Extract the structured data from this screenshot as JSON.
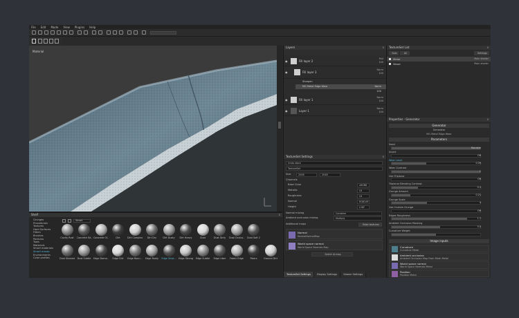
{
  "menu": [
    "File",
    "Edit",
    "Mode",
    "View",
    "Plugins",
    "Help"
  ],
  "viewport": {
    "label": "Material"
  },
  "shelf": {
    "title": "Shelf",
    "search": "Smart",
    "categories": [
      "Grunges",
      "Procedurals",
      "Textures",
      "Hard Surfaces",
      "Filters",
      "Brushes",
      "Particles",
      "Tools",
      "Materials",
      "Smart materials",
      "Smart masks",
      "Environments",
      "Color profiles"
    ],
    "selected_category": "Smart masks",
    "row1": [
      "Cavity Rust",
      "Concrete Ed...",
      "Concrete Ol...",
      "Dirt",
      "Dirt Complex",
      "Dirt Dry",
      "Dirt Dusty",
      "Dirt Heavy",
      "Dust",
      "Dust Dirty",
      "Dust Occlus...",
      "Dust Soft 2"
    ],
    "row2": [
      "Dust Stained",
      "Dust Subtle",
      "Edge Dama...",
      "Edge Dirt",
      "Edge Roun...",
      "Edge Rusty",
      "Edge Smal...",
      "Edge Strong",
      "Edge Subtle",
      "Edge Uber",
      "Fabric Edge",
      "Fibers",
      "Ground Dirt"
    ],
    "selected_material": "Edge Smal..."
  },
  "layers": {
    "title": "Layers",
    "items": [
      {
        "name": "Fill layer 2",
        "blend": "Mul",
        "opacity": "100"
      },
      {
        "name": "Fill layer 3",
        "blend": "Norm",
        "opacity": "100"
      },
      {
        "name": "Fill layer 1",
        "blend": "Norm",
        "opacity": "100"
      },
      {
        "name": "Layer 1",
        "blend": "Norm",
        "opacity": "100"
      }
    ],
    "effects": [
      {
        "name": "Sharpen",
        "blend": "",
        "opacity": ""
      },
      {
        "name": "MG Metal Edge Wear",
        "blend": "Norm",
        "opacity": "100"
      }
    ]
  },
  "textureset_settings": {
    "title": "TextureSet Settings",
    "undo": "Undo stack",
    "textureset": "TextureSet",
    "size_label": "Size",
    "size_value": "2048",
    "channels_label": "Channels",
    "channels": [
      {
        "name": "Base Color",
        "format": "sRGB8"
      },
      {
        "name": "Metallic",
        "format": "L8"
      },
      {
        "name": "Roughness",
        "format": "L8"
      },
      {
        "name": "Normal",
        "format": "RGB16F"
      },
      {
        "name": "Height",
        "format": "L16F"
      }
    ],
    "normal_mixing_label": "Normal mixing",
    "normal_mixing_value": "Combine",
    "ao_label": "Ambient occlusion mixing",
    "ao_value": "Multiply",
    "additional_maps": "Additional maps",
    "bake_button": "Bake textures",
    "maps": [
      {
        "title": "Normal",
        "sub": "NormalNormalMap"
      },
      {
        "title": "World space normal",
        "sub": "World Space Normals Map"
      }
    ],
    "select_button": "Select id map",
    "tabs": [
      "TextureSet Settings",
      "Display Settings",
      "Viewer Settings"
    ]
  },
  "textureset_list": {
    "title": "TextureSet List",
    "solo_label": "Solo",
    "all_label": "All",
    "settings_label": "Settings",
    "items": [
      {
        "name": "Metal",
        "shader": "Main shader"
      },
      {
        "name": "Wood",
        "shader": "Main shader"
      }
    ]
  },
  "properties": {
    "title": "Properties - Generator",
    "generator_header": "Generator",
    "generator_label": "Generator",
    "generator_value": "MG Metal Edge Wear",
    "parameters_header": "Parameters",
    "params": [
      {
        "label": "Seed",
        "value": "Random",
        "fill": 1.0
      },
      {
        "label": "Invert",
        "value": "Off",
        "fill": 0
      },
      {
        "label": "Wear Level",
        "value": "0.39",
        "fill": 0.39
      },
      {
        "label": "Wear Contrast",
        "value": "1",
        "fill": 1.0
      },
      {
        "label": "Use Triplanar",
        "value": "Off",
        "fill": 0
      },
      {
        "label": "Triplanar Blending Contrast",
        "value": "0.3",
        "fill": 0.3
      },
      {
        "label": "Grunge Amount",
        "value": "0.21",
        "fill": 0.21
      },
      {
        "label": "Grunge Scale",
        "value": "4",
        "fill": 0.4
      },
      {
        "label": "Use Custom Grunge",
        "value": "Off",
        "fill": 0
      },
      {
        "label": "Edges Roughness",
        "value": "1.7",
        "fill": 0.85
      },
      {
        "label": "Ambient Occlusion Masking",
        "value": "5.5",
        "fill": 0.55
      },
      {
        "label": "Curvature Weight",
        "value": "",
        "fill": 0.5
      }
    ],
    "image_inputs_header": "Image inputs",
    "inputs": [
      {
        "title": "Curvature",
        "sub": "Curvature Metal",
        "color": "#4e7d8c"
      },
      {
        "title": "Ambient occlusion",
        "sub": "Ambient Occlusion Map From Mesh Metal",
        "color": "#dcdcdc"
      },
      {
        "title": "World space normal",
        "sub": "World Space Normals Metal",
        "color": "#7a6ab0"
      },
      {
        "title": "Position",
        "sub": "Position Metal",
        "color": "#8f5fa3"
      }
    ]
  },
  "colors": {
    "accent": "#53b6d6",
    "bg": "#2f3339"
  }
}
